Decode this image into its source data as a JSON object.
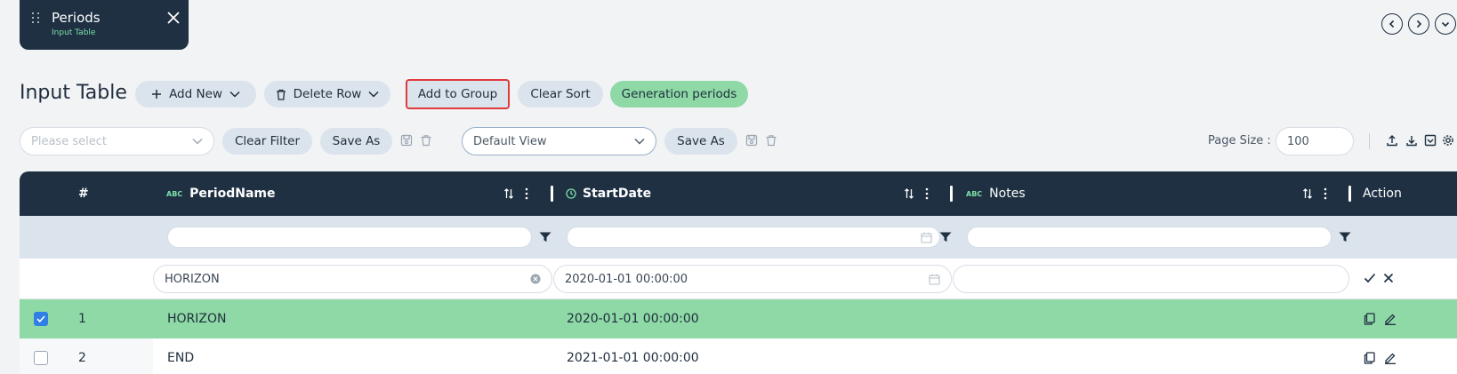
{
  "tab": {
    "title": "Periods",
    "subtitle": "Input Table"
  },
  "toolbar": {
    "page_title": "Input Table",
    "add_new": "Add New",
    "delete_row": "Delete Row",
    "add_to_group": "Add to Group",
    "clear_sort": "Clear Sort",
    "generation_periods": "Generation periods"
  },
  "filters": {
    "select_placeholder": "Please select",
    "clear_filter": "Clear Filter",
    "save_as": "Save As",
    "view_value": "Default View",
    "save_as_view": "Save As",
    "page_size_label": "Page Size :",
    "page_size_value": "100"
  },
  "table": {
    "columns": [
      {
        "key": "index",
        "label": "#"
      },
      {
        "key": "period_name",
        "label": "PeriodName",
        "type_tag": "ABC"
      },
      {
        "key": "start_date",
        "label": "StartDate",
        "type_icon": "clock-icon"
      },
      {
        "key": "notes",
        "label": "Notes",
        "type_tag": "ABC"
      },
      {
        "key": "action",
        "label": "Action"
      }
    ],
    "edit_row": {
      "period_name": "HORIZON",
      "start_date": "2020-01-01 00:00:00",
      "notes": ""
    },
    "rows": [
      {
        "index": "1",
        "period_name": "HORIZON",
        "start_date": "2020-01-01 00:00:00",
        "checked": true
      },
      {
        "index": "2",
        "period_name": "END",
        "start_date": "2021-01-01 00:00:00",
        "checked": false
      }
    ]
  },
  "colors": {
    "header_bg": "#1e3042",
    "accent_green": "#8ed9a6",
    "pill_bg": "#dbe4ec",
    "highlight_border": "#e03b3b"
  }
}
